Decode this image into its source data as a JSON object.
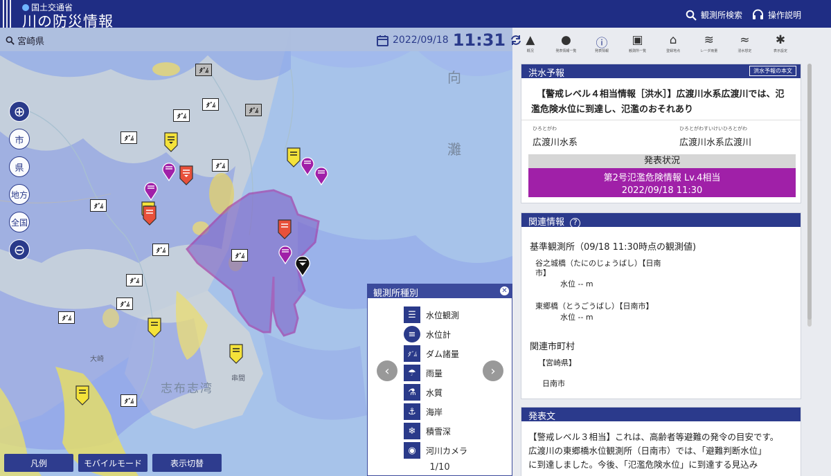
{
  "header": {
    "ministry": "国土交通省",
    "title": "川の防災情報",
    "search_label": "観測所検索",
    "help_label": "操作説明"
  },
  "location": {
    "prefecture": "宮崎県",
    "date": "2022/09/18",
    "time": "11:31"
  },
  "zoom": {
    "city": "市",
    "prefecture": "県",
    "region": "地方",
    "nation": "全国"
  },
  "map_labels": {
    "sea": "灘",
    "sea2": "向",
    "bay": "志布志湾",
    "place": "隅",
    "place2": "大崎",
    "place3": "串間"
  },
  "dam_label": "ﾀﾞﾑ",
  "legend": {
    "title": "観測所種別",
    "items": [
      {
        "icon": "water-level-observation-icon",
        "label": "水位観測"
      },
      {
        "icon": "water-level-gauge-icon",
        "label": "水位計"
      },
      {
        "icon": "dam-icon",
        "label": "ダム諸量"
      },
      {
        "icon": "umbrella-icon",
        "label": "雨量"
      },
      {
        "icon": "flask-icon",
        "label": "水質"
      },
      {
        "icon": "anchor-icon",
        "label": "海岸"
      },
      {
        "icon": "snowflake-icon",
        "label": "積雪深"
      },
      {
        "icon": "camera-icon",
        "label": "河川カメラ"
      }
    ],
    "page": "1/10"
  },
  "bottom_buttons": {
    "legend": "凡例",
    "mobile": "モバイルモード",
    "toggle": "表示切替"
  },
  "icon_bar": [
    {
      "icon": "warning-icon",
      "label": "概況"
    },
    {
      "icon": "alert-list-icon",
      "label": "発表情報一覧"
    },
    {
      "icon": "alert-info-icon",
      "label": "発表情報"
    },
    {
      "icon": "station-list-icon",
      "label": "観測所一覧"
    },
    {
      "icon": "home-icon",
      "label": "登録地点"
    },
    {
      "icon": "radar-icon",
      "label": "レーダ雨量"
    },
    {
      "icon": "flood-icon",
      "label": "浸水想定"
    },
    {
      "icon": "settings-icon",
      "label": "表示設定"
    }
  ],
  "forecast": {
    "section_title": "洪水予報",
    "full_text_button": "洪水予報の本文",
    "headline1": "【警戒レベル４相当情報［洪水］】広渡川水系広渡川では、氾",
    "headline2": "濫危険水位に到達し、氾濫のおそれあり",
    "system_ruby": "ひろとがわ",
    "system_name": "広渡川水系",
    "river_ruby": "ひろとがわすいけいひろとがわ",
    "river_name": "広渡川水系広渡川",
    "status_title": "発表状況",
    "status_level": "第2号氾濫危険情報 Lv.4相当",
    "status_time": "2022/09/18 11:30"
  },
  "related": {
    "section_title": "関連情報",
    "reference_heading": "基準観測所（09/18 11:30時点の観測値)",
    "station1_line1": "谷之城橋（たにのじょうばし）【日南",
    "station1_line2": "市】",
    "station1_value": "水位 -- m",
    "station2_line1": "東郷橋（とうごうばし）【日南市】",
    "station2_value": "水位 -- m",
    "municipality_heading": "関連市町村",
    "prefecture": "【宮崎県】",
    "city": "日南市"
  },
  "announcement": {
    "section_title": "発表文",
    "line1": "【警戒レベル３相当】これは、高齢者等避難の発令の目安です。",
    "line2": "広渡川の東郷橋水位観測所（日南市）では、「避難判断水位」",
    "line3": "に到達しました。今後、「氾濫危険水位」に到達する見込み"
  },
  "colors": {
    "header_bg": "#1f2d84",
    "status_purple": "#a020a8",
    "level_red": "#e8503a",
    "level_yellow": "#f4e23a",
    "basin_outline": "#a02aa0"
  }
}
